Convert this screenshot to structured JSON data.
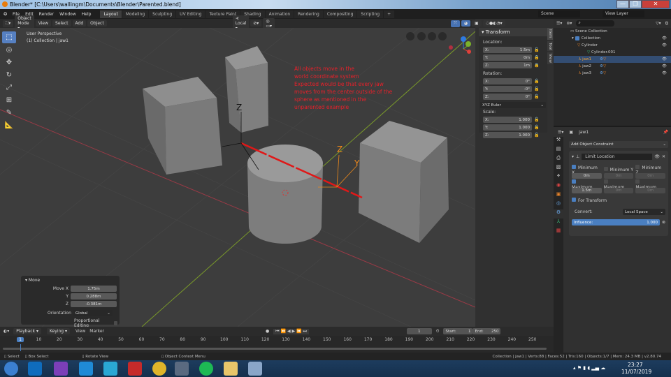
{
  "window": {
    "title": "Blender* [C:\\Users\\wallingm\\Documents\\Blender\\Parented.blend]",
    "min": "—",
    "max": "❐",
    "close": "✕"
  },
  "menu": [
    "File",
    "Edit",
    "Render",
    "Window",
    "Help"
  ],
  "workspaces": [
    "Layout",
    "Modeling",
    "Sculpting",
    "UV Editing",
    "Texture Paint",
    "Shading",
    "Animation",
    "Rendering",
    "Compositing",
    "Scripting"
  ],
  "scene": {
    "scene_label": "Scene",
    "view_layer": "View Layer"
  },
  "viewport_header": {
    "mode": "Object Mode",
    "menus": [
      "View",
      "Select",
      "Add",
      "Object"
    ],
    "pivot": "Local"
  },
  "viewport": {
    "perspective": "User Perspective",
    "collection": "(1) Collection | jaw1",
    "note": [
      "All objects move in the",
      "world coordinate system",
      "Expected would be that every jaw",
      "moves from the center outside of the",
      "sphere as mentioned in the",
      "unparented example"
    ]
  },
  "transform": {
    "title": "Transform",
    "location_label": "Location:",
    "location": [
      {
        "axis": "X:",
        "value": "1.5m"
      },
      {
        "axis": "Y:",
        "value": "0m"
      },
      {
        "axis": "Z:",
        "value": "1m"
      }
    ],
    "rotation_label": "Rotation:",
    "rotation": [
      {
        "axis": "X:",
        "value": "0°"
      },
      {
        "axis": "Y:",
        "value": "-0°"
      },
      {
        "axis": "Z:",
        "value": "0°"
      }
    ],
    "rotation_mode": "XYZ Euler",
    "scale_label": "Scale:",
    "scale": [
      {
        "axis": "X:",
        "value": "1.000"
      },
      {
        "axis": "Y:",
        "value": "1.000"
      },
      {
        "axis": "Z:",
        "value": "1.000"
      }
    ]
  },
  "sidebar_tabs": [
    "Item",
    "Tool",
    "View"
  ],
  "outliner": {
    "items": [
      {
        "label": "Scene Collection"
      },
      {
        "label": "Collection"
      },
      {
        "label": "Cylinder"
      },
      {
        "label": "Cylinder.001"
      },
      {
        "label": "jaw1"
      },
      {
        "label": "jaw2"
      },
      {
        "label": "jaw3"
      }
    ]
  },
  "properties": {
    "object": "jaw1",
    "add_constraint": "Add Object Constraint",
    "constraint_name": "Limit Location",
    "min": [
      {
        "label": "Minimum X",
        "checked": true,
        "value": "0m"
      },
      {
        "label": "Minimum Y",
        "checked": false,
        "value": "0m"
      },
      {
        "label": "Minimum Z",
        "checked": false,
        "value": "0m"
      }
    ],
    "max": [
      {
        "label": "Maximum...",
        "checked": true,
        "value": "1.5m"
      },
      {
        "label": "Maximum...",
        "checked": false,
        "value": "0m"
      },
      {
        "label": "Maximum...",
        "checked": false,
        "value": "0m"
      }
    ],
    "for_transform": "For Transform",
    "convert_label": "Convert:",
    "convert_value": "Local Space",
    "influence_label": "Influence:",
    "influence_value": "1.000"
  },
  "move_panel": {
    "title": "Move",
    "fields": [
      {
        "label": "Move X",
        "value": "1.75m"
      },
      {
        "label": "Y",
        "value": "0.288m"
      },
      {
        "label": "Z",
        "value": "-0.381m"
      }
    ],
    "orientation_label": "Orientation",
    "orientation": "Global",
    "proportional": "Proportional Editing"
  },
  "timeline": {
    "menus": [
      "Playback",
      "Keying",
      "View",
      "Marker"
    ],
    "current_frame": "1",
    "start_label": "Start:",
    "start": "1",
    "end_label": "End:",
    "end": "250",
    "ticks": [
      "1",
      "10",
      "20",
      "30",
      "40",
      "50",
      "60",
      "70",
      "80",
      "90",
      "100",
      "110",
      "120",
      "130",
      "140",
      "150",
      "160",
      "170",
      "180",
      "190",
      "200",
      "210",
      "220",
      "230",
      "240",
      "250"
    ]
  },
  "statusbar": {
    "select": "Select",
    "box_select": "Box Select",
    "rotate": "Rotate View",
    "context": "Object Context Menu",
    "info": "Collection | jaw1 | Verts:88 | Faces:52 | Tris:160 | Objects:1/7 | Mem: 24.3 MB | v2.80.74"
  },
  "taskbar": {
    "time": "23:27",
    "date": "11/07/2019"
  },
  "colors": {
    "accent": "#5680c2",
    "note": "#e8202a",
    "selected_row": "#334d72"
  }
}
